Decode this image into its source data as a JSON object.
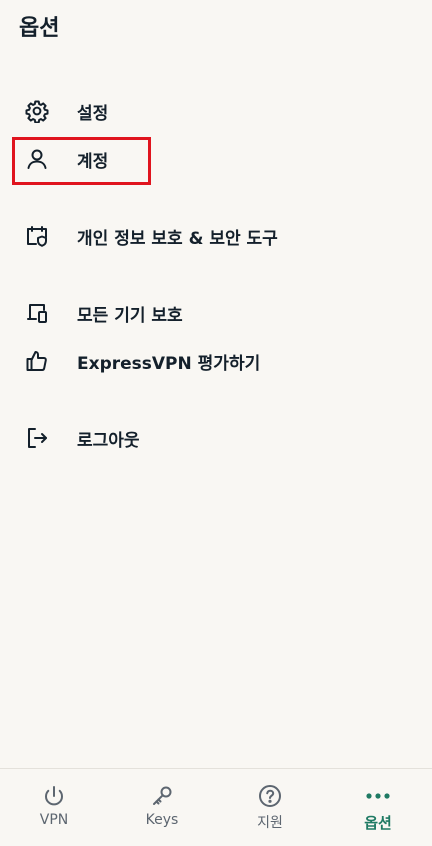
{
  "header": {
    "title": "옵션"
  },
  "menu": {
    "settings": "설정",
    "account": "계정",
    "privacy_tools": "개인 정보 보호 & 보안 도구",
    "all_devices": "모든 기기 보호",
    "rate_app": "ExpressVPN 평가하기",
    "logout": "로그아웃"
  },
  "tabs": {
    "vpn": "VPN",
    "keys": "Keys",
    "support": "지원",
    "options": "옵션"
  },
  "highlight": {
    "target": "account",
    "color": "#e0141e"
  },
  "colors": {
    "text": "#14202b",
    "active": "#1f7a63",
    "inactive": "#5d6670",
    "background": "#f9f7f3"
  },
  "icons": {
    "settings": "gear-icon",
    "account": "person-icon",
    "privacy_tools": "shield-calendar-icon",
    "all_devices": "devices-icon",
    "rate_app": "thumbs-up-icon",
    "logout": "logout-icon",
    "vpn": "power-icon",
    "keys": "key-icon",
    "support": "question-icon",
    "options": "more-dots-icon"
  }
}
